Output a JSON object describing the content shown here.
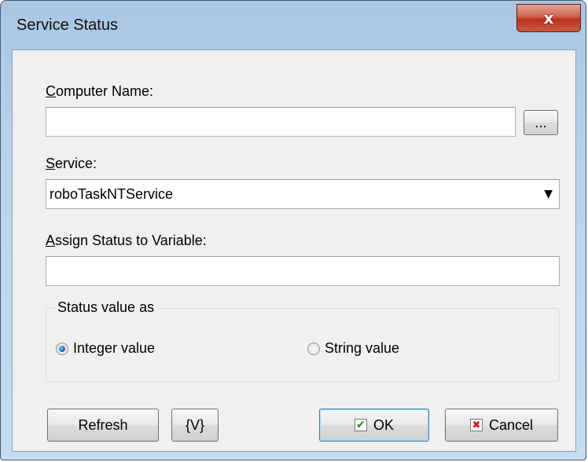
{
  "window": {
    "title": "Service Status",
    "close_symbol": "x"
  },
  "computer_name": {
    "label_accel": "C",
    "label_rest": "omputer Name:",
    "value": "",
    "browse_label": "..."
  },
  "service": {
    "label_accel": "S",
    "label_rest": "ervice:",
    "value": "roboTaskNTService",
    "dropdown_arrow": "▼"
  },
  "assign": {
    "label_accel": "A",
    "label_rest": "ssign Status to Variable:",
    "value": ""
  },
  "status_group": {
    "title": "Status value as",
    "options": [
      {
        "label": "Integer value",
        "checked": true
      },
      {
        "label": "String value",
        "checked": false
      }
    ]
  },
  "buttons": {
    "refresh": "Refresh",
    "variable": "{V}",
    "ok": "OK",
    "ok_icon": "✔",
    "cancel": "Cancel",
    "cancel_icon": "✖"
  },
  "colors": {
    "ok_check": "#1a8a1a",
    "cancel_x": "#d11b1b"
  }
}
